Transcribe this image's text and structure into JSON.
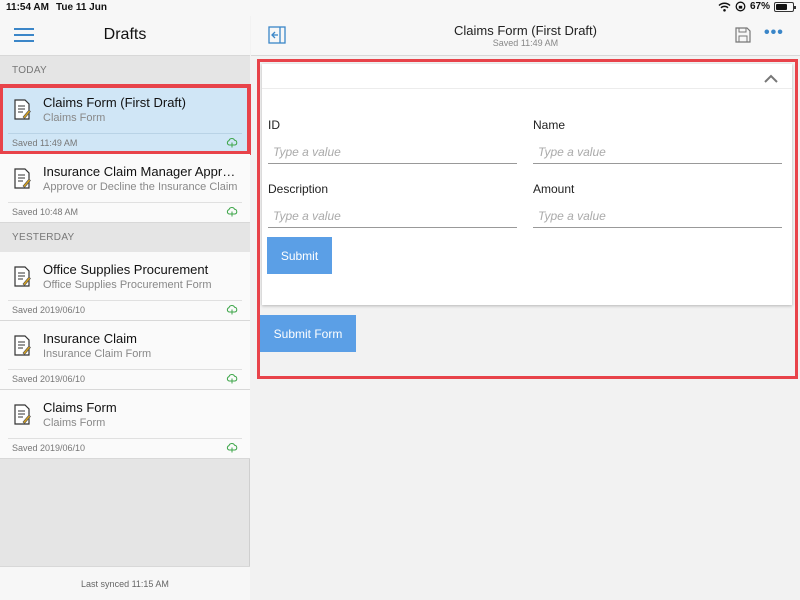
{
  "status_bar": {
    "time": "11:54 AM",
    "date": "Tue 11 Jun",
    "battery": "67%",
    "battery_level": 0.67
  },
  "sidebar": {
    "title": "Drafts",
    "sections": [
      {
        "label": "TODAY",
        "items": [
          {
            "title": "Claims Form (First Draft)",
            "subtitle": "Claims Form",
            "saved": "Saved 11:49 AM",
            "selected": true
          },
          {
            "title": "Insurance Claim Manager Approval",
            "subtitle": "Approve or Decline the Insurance Claim",
            "saved": "Saved 10:48 AM",
            "selected": false
          }
        ]
      },
      {
        "label": "YESTERDAY",
        "items": [
          {
            "title": "Office Supplies Procurement",
            "subtitle": "Office Supplies Procurement Form",
            "saved": "Saved 2019/06/10",
            "selected": false
          },
          {
            "title": "Insurance Claim",
            "subtitle": "Insurance Claim Form",
            "saved": "Saved 2019/06/10",
            "selected": false
          },
          {
            "title": "Claims Form",
            "subtitle": "Claims Form",
            "saved": "Saved 2019/06/10",
            "selected": false
          }
        ]
      }
    ],
    "footer": "Last synced 11:15 AM"
  },
  "main": {
    "title": "Claims Form (First Draft)",
    "subtitle": "Saved 11:49 AM",
    "form": {
      "fields": {
        "id": {
          "label": "ID",
          "placeholder": "Type a value",
          "value": ""
        },
        "name": {
          "label": "Name",
          "placeholder": "Type a value",
          "value": ""
        },
        "description": {
          "label": "Description",
          "placeholder": "Type a value",
          "value": ""
        },
        "amount": {
          "label": "Amount",
          "placeholder": "Type a value",
          "value": ""
        }
      },
      "submit_label": "Submit"
    },
    "submit_form_label": "Submit Form"
  },
  "colors": {
    "accent": "#3b86c8",
    "button": "#5b9fe6",
    "highlight": "#e8434a",
    "selected_bg": "#d0e6f6",
    "cloud": "#3ea64a"
  },
  "icons": [
    "menu-icon",
    "sidebar-collapse-icon",
    "save-icon",
    "more-icon",
    "chevron-up-icon",
    "document-icon",
    "cloud-sync-icon",
    "wifi-icon",
    "lock-rotation-icon",
    "battery-icon"
  ]
}
